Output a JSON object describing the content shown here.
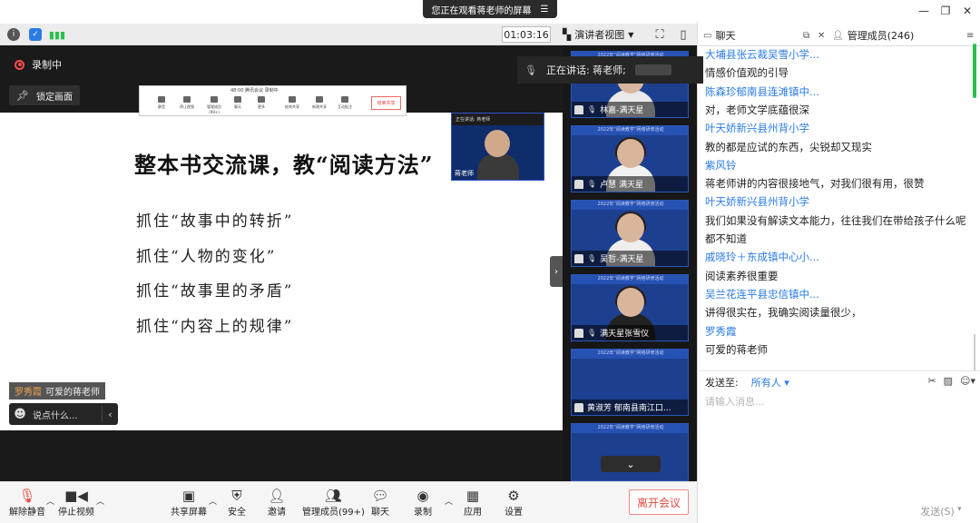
{
  "window": {
    "share_banner": "您正在观看蒋老师的屏幕",
    "banner_icon": "menu-lines-icon"
  },
  "status": {
    "timer": "01:03:16",
    "view_mode": "演讲者视图"
  },
  "stage": {
    "recording_label": "录制中",
    "lock_label": "锁定画面",
    "speaking_label": "正在讲话: 蒋老师;",
    "teacher_video_name": "蒋老师",
    "teacher_video_header": "正在讲话: 蒋老师"
  },
  "slide": {
    "title": "整本书交流课，教“阅读方法”",
    "bullets": [
      "抓住“故事中的转折”",
      "抓住“人物的变化”",
      "抓住“故事里的矛盾”",
      "抓住“内容上的规律”"
    ],
    "mini_toolbar": {
      "status": "48:00  腾讯会议  录制中",
      "items": [
        "静音",
        "停止视频",
        "管理成员(99+)",
        "聊天",
        "更多",
        "结束共享",
        "新建共享",
        "互动批注"
      ],
      "leave": "结束共享"
    }
  },
  "chat_toast": {
    "sender": "罗秀霞",
    "message": "可爱的蒋老师"
  },
  "say_box": {
    "placeholder": "说点什么..."
  },
  "participants": [
    {
      "name": "林嘉-满天星",
      "banner": "2022年“阅读教学”网络研修活动"
    },
    {
      "name": "卢慧 满天星",
      "banner": "2022年“阅读教学”网络研修活动"
    },
    {
      "name": "吴哲-满天星",
      "banner": "2022年“阅读教学”网络研修活动"
    },
    {
      "name": "满天星张雪仪",
      "banner": "2022年“阅读教学”网络研修活动"
    },
    {
      "name": "黄淑芳    郁南县南江口...",
      "banner": "2022年“阅读教学”网络研修活动"
    },
    {
      "name": "",
      "banner": "2022年“阅读教学”网络研修活动"
    }
  ],
  "toolbar": {
    "unmute": "解除静音",
    "stop_video": "停止视频",
    "share_screen": "共享屏幕",
    "security": "安全",
    "invite": "邀请",
    "members": "管理成员(99+)",
    "chat": "聊天",
    "record": "录制",
    "apps": "应用",
    "settings": "设置",
    "leave": "离开会议"
  },
  "chat_panel": {
    "tab_chat": "聊天",
    "tab_members": "管理成员(246)",
    "messages": [
      {
        "kind": "name",
        "text": "大埔县张云裁吴雪小学..."
      },
      {
        "kind": "text",
        "text": "情感价值观的引导"
      },
      {
        "kind": "name",
        "text": "陈森珍郁南县连滩镇中..."
      },
      {
        "kind": "text",
        "text": "对，老师文学底蕴很深"
      },
      {
        "kind": "name",
        "text": "叶天娇新兴县州背小学"
      },
      {
        "kind": "text",
        "text": "教的都是应试的东西，尖锐却又现实"
      },
      {
        "kind": "name",
        "text": "紫风铃"
      },
      {
        "kind": "text",
        "text": "蒋老师讲的内容很接地气，对我们很有用，很赞"
      },
      {
        "kind": "name",
        "text": "叶天娇新兴县州背小学"
      },
      {
        "kind": "text",
        "text": "我们如果没有解读文本能力，往往我们在带给孩子什么呢"
      },
      {
        "kind": "text",
        "text": "都不知道"
      },
      {
        "kind": "name",
        "text": "戚晓玲＋东成镇中心小..."
      },
      {
        "kind": "text",
        "text": "阅读素养很重要"
      },
      {
        "kind": "name",
        "text": "吴兰花连平县忠信镇中..."
      },
      {
        "kind": "text",
        "text": "讲得很实在，我确实阅读量很少，"
      },
      {
        "kind": "name",
        "text": "罗秀霞"
      },
      {
        "kind": "text",
        "text": "可爱的蒋老师"
      }
    ],
    "send_to_label": "发送至:",
    "recipient": "所有人",
    "input_placeholder": "请输入消息...",
    "send_label": "发送(S)"
  },
  "colors": {
    "accent_blue": "#2a7be4",
    "leave_red": "#e54a41",
    "scroll_green": "#2bbf4f",
    "toast_name_orange": "#f3a44a"
  }
}
